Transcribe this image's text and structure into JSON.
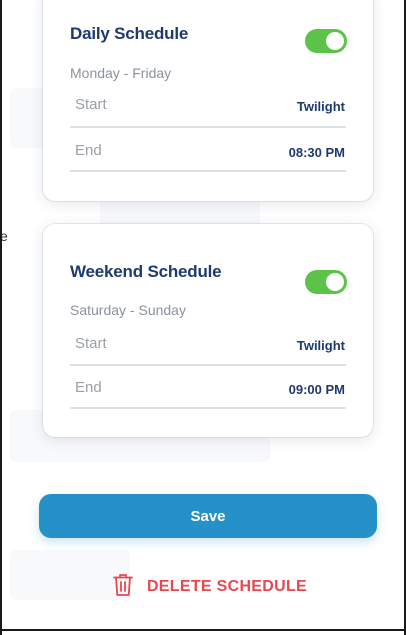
{
  "background_fragment": "e",
  "schedules": [
    {
      "title": "Daily Schedule",
      "days": "Monday - Friday",
      "enabled": true,
      "start_label": "Start",
      "start_value": "Twilight",
      "end_label": "End",
      "end_value": "08:30 PM"
    },
    {
      "title": "Weekend Schedule",
      "days": "Saturday - Sunday",
      "enabled": true,
      "start_label": "Start",
      "start_value": "Twilight",
      "end_label": "End",
      "end_value": "09:00 PM"
    }
  ],
  "actions": {
    "save_label": "Save",
    "delete_label": "DELETE SCHEDULE",
    "delete_icon": "trash-icon"
  },
  "colors": {
    "accent": "#2690c8",
    "toggle_on": "#5cc24a",
    "danger": "#e8474f",
    "title": "#1e3a6e"
  }
}
